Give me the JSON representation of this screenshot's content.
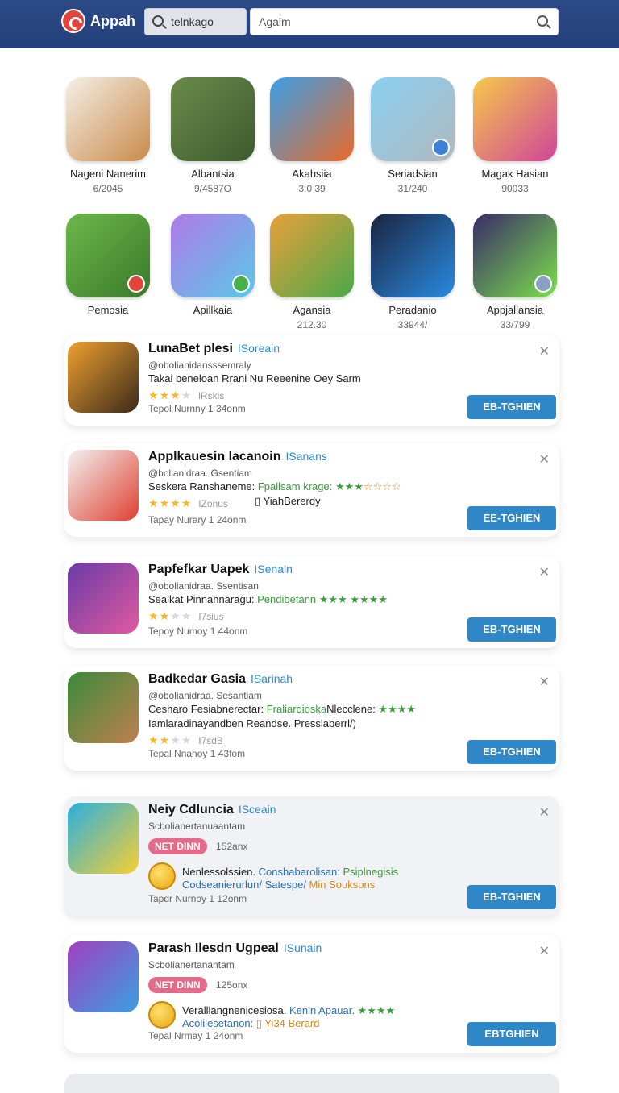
{
  "header": {
    "brand": "Appah",
    "search_chip": "telnkago",
    "search_placeholder": "Agaim"
  },
  "grid": [
    {
      "name": "Nageni Nanerim",
      "num": "6/2045",
      "colors": [
        "#f4efe6",
        "#c98a4a"
      ],
      "badge": ""
    },
    {
      "name": "Albantsia",
      "num": "9/4587O",
      "colors": [
        "#6a8a4a",
        "#3e5a2e"
      ],
      "badge": ""
    },
    {
      "name": "Akahsiia",
      "num": "3:0 39",
      "colors": [
        "#3aa0e8",
        "#e86a2a"
      ],
      "badge": ""
    },
    {
      "name": "Seriadsian",
      "num": "31/240",
      "colors": [
        "#8ad0f0",
        "#b0b8c0"
      ],
      "badge": "blue"
    },
    {
      "name": "Magak Hasian",
      "num": "90033",
      "colors": [
        "#f6c84a",
        "#d0459a"
      ],
      "badge": ""
    },
    {
      "name": "Pemosia",
      "num": "",
      "colors": [
        "#6cb84a",
        "#3a7a2a"
      ],
      "badge": "red"
    },
    {
      "name": "Apillkaia",
      "num": "",
      "colors": [
        "#b07ae8",
        "#5ac8e8"
      ],
      "badge": "green"
    },
    {
      "name": "Agansia",
      "num": "212.30",
      "colors": [
        "#e8a03a",
        "#4aa84a"
      ],
      "badge": ""
    },
    {
      "name": "Peradanio",
      "num": "33944/",
      "colors": [
        "#1a2440",
        "#2a8ae0"
      ],
      "badge": ""
    },
    {
      "name": "Appjallansia",
      "num": "33/799",
      "colors": [
        "#3a2a6a",
        "#7ae04a"
      ],
      "badge": "gray"
    }
  ],
  "cards": [
    {
      "title": "LunaBet plesi",
      "tag": "ISoreain",
      "sub": "@obolianidansssemraly",
      "desc": "Takai beneloan Rrani Nu Reeenine Oey Sarm",
      "rating": 3,
      "rating_text": "lRskis",
      "meta": "Tepol Nurnny 1 34onm",
      "btn": "EB-TGHIEN",
      "colors": [
        "#f0a030",
        "#3a2a1a"
      ]
    },
    {
      "title": "Applkauesin Iacanoin",
      "tag": "ISanans",
      "sub": "@bolianidraa. Gsentiam",
      "desc": "Seskera Ranshaneme: ",
      "desc_green": "Fpallsam krage: ★★★",
      "desc_tail": "☆☆☆☆",
      "extra": "▯ YiahBererdy",
      "rating": 4,
      "rating_text": "IZonus",
      "meta": "Tapay Nurary 1 24onm",
      "btn": "EE-TGHIEN",
      "colors": [
        "#f2f2f2",
        "#e04030"
      ]
    },
    {
      "title": "Papfefkar Uapek",
      "tag": "ISenaln",
      "sub": "@obolianidraa. Ssentisan",
      "desc": "Sealkat Pinnahnaragu: ",
      "desc_green": "Pendibetann ★★★  ★★★★",
      "rating": 2,
      "rating_text": "I7sius",
      "meta": "Tepoy Numoy 1 44onm",
      "btn": "EB-TGHIEN",
      "colors": [
        "#6a3aa8",
        "#e05aa0"
      ]
    },
    {
      "title": "Badkedar Gasia",
      "tag": "ISarinah",
      "sub": "@obolianidraa. Sesantiam",
      "desc": "Cesharo Fesiabnerectar: ",
      "desc_green": "Fraliaroioska",
      "desc_mid": "Nlecclene: ",
      "desc_green2": "★★★★",
      "desc2": "Iamlaradinayandben Reandse.",
      "desc2_tail": " Presslaberrl/)",
      "rating": 2,
      "rating_text": "I7sdB",
      "meta": "Tepal Nnanoy 1 43fom",
      "btn": "EB-TGHIEN",
      "colors": [
        "#3a8a3a",
        "#c08050"
      ]
    },
    {
      "title": "Neiy Cdluncia",
      "tag": "ISceain",
      "sub": "Scbolianertanuaantam",
      "pill": "NET DINN",
      "pill_num": "152anx",
      "desc": "Nenlessolssien. ",
      "desc_b": "Conshabarolisan: ",
      "desc_green": "Psiplnegisis",
      "desc2": "Codseanierurlun/ Satespe/",
      "desc2_o": " Min Souksons",
      "meta": "Tapdr Nurnoy 1 12onm",
      "btn": "EB-TGHIEN",
      "colors": [
        "#2ab0e0",
        "#f6d030"
      ]
    },
    {
      "title": "Parash Ilesdn Ugpeal",
      "tag": "ISunain",
      "sub": "Scbolianertanantam",
      "pill": "NET DINN",
      "pill_num": "125onx",
      "desc": "Veralllangnenicesiosa. ",
      "desc_b": "Kenin Apauar. ",
      "desc_green": "★★★★",
      "desc2": "Acolilesetanon:",
      "desc2_o": " ▯ Yi34 Berard",
      "meta": "Tepal Nrmay 1 24onm",
      "btn": "EBTGHIEN",
      "colors": [
        "#a040c0",
        "#3aa0e0"
      ]
    }
  ]
}
